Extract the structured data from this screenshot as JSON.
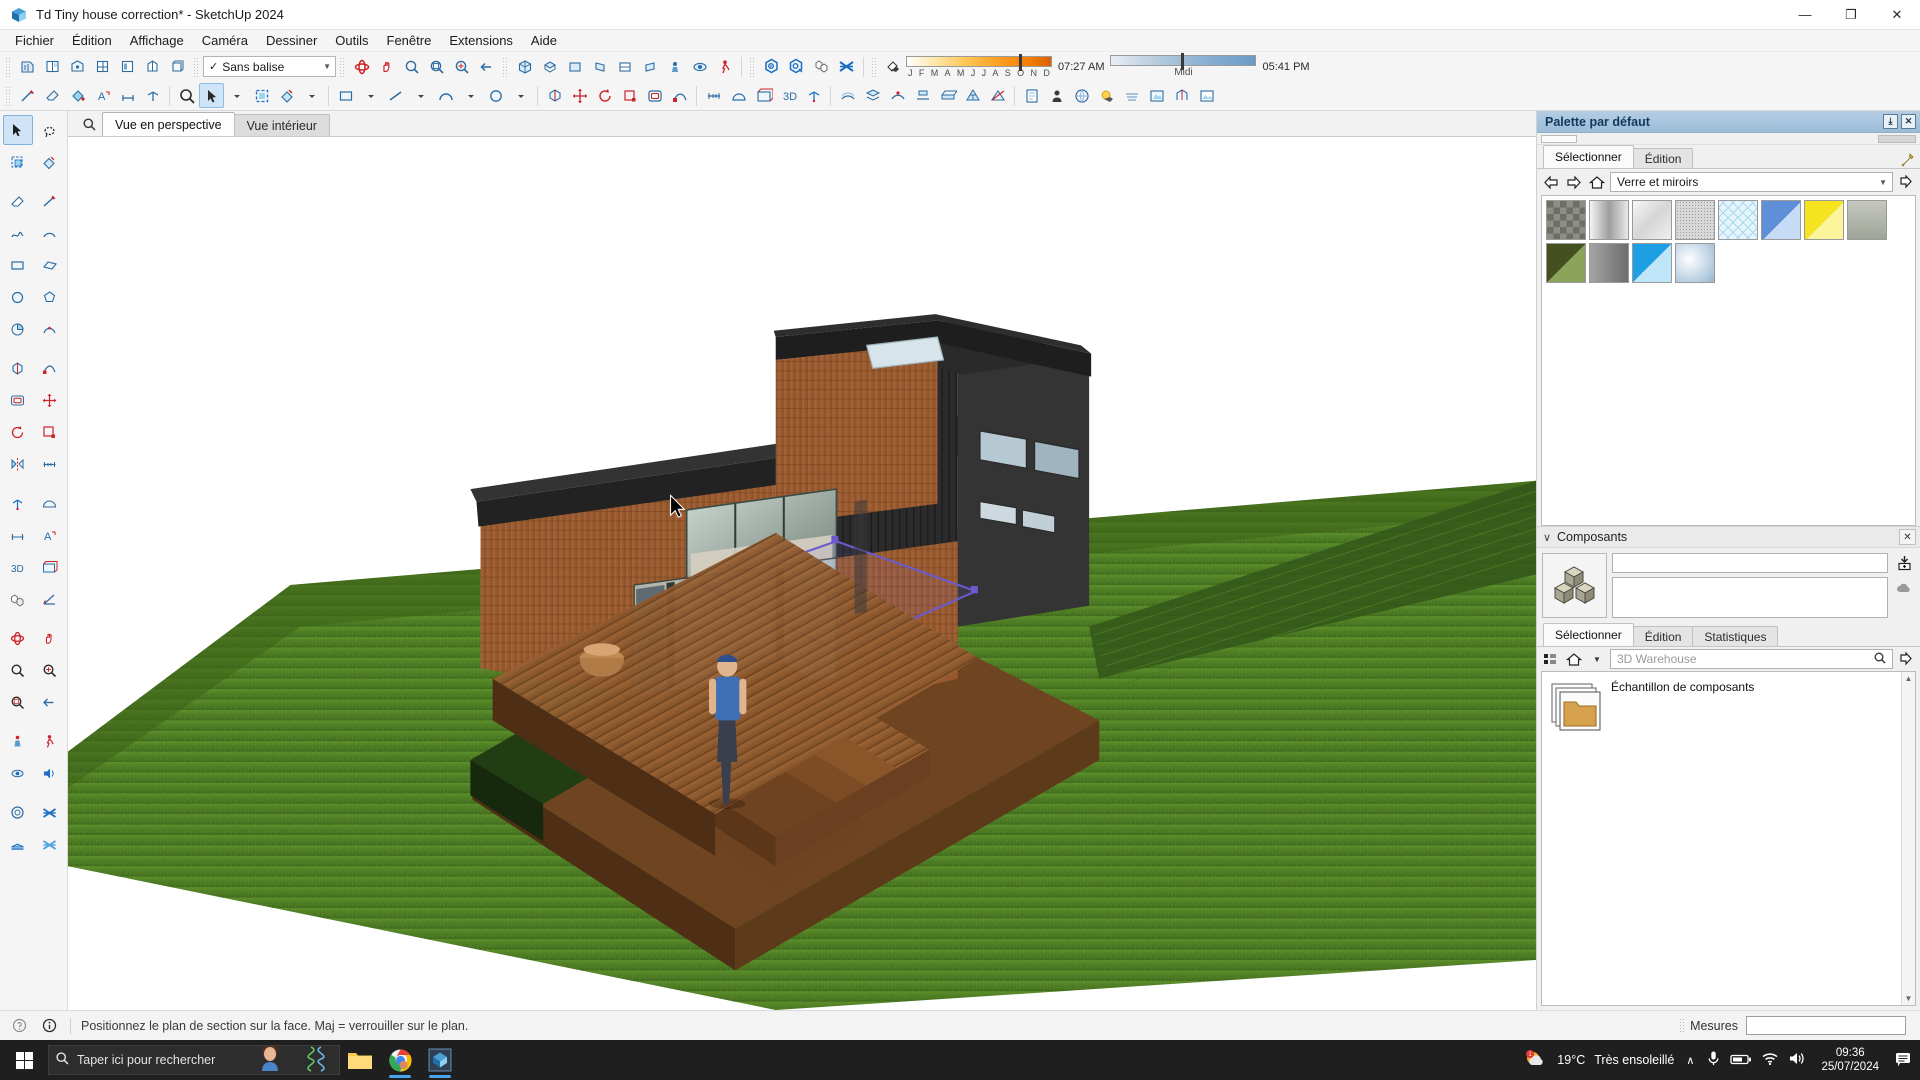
{
  "window": {
    "title": "Td Tiny house correction* - SketchUp 2024",
    "app_icon": "sketchup-icon",
    "minimize": "—",
    "maximize": "❐",
    "close": "✕"
  },
  "menubar": {
    "items": [
      {
        "label": "Fichier"
      },
      {
        "label": "Édition"
      },
      {
        "label": "Affichage"
      },
      {
        "label": "Caméra"
      },
      {
        "label": "Dessiner"
      },
      {
        "label": "Outils"
      },
      {
        "label": "Fenêtre"
      },
      {
        "label": "Extensions"
      },
      {
        "label": "Aide"
      }
    ]
  },
  "toolbar": {
    "tag_selector": {
      "check": "✓",
      "value": "Sans balise",
      "arrow": "▼"
    },
    "shadow": {
      "months": [
        "J",
        "F",
        "M",
        "A",
        "M",
        "J",
        "J",
        "A",
        "S",
        "O",
        "N",
        "D"
      ],
      "sunrise": "07:27 AM",
      "noon_label": "Midi",
      "sunset": "05:41 PM"
    }
  },
  "view_tabs": {
    "search_icon": "search-icon",
    "tabs": [
      {
        "label": "Vue en perspective",
        "active": true
      },
      {
        "label": "Vue intérieur",
        "active": false
      }
    ]
  },
  "palette_panel": {
    "title": "Palette par défaut",
    "pin_glyph": "⤓",
    "close_glyph": "✕",
    "tabs": [
      {
        "label": "Sélectionner",
        "active": true
      },
      {
        "label": "Édition",
        "active": false
      }
    ],
    "eyedropper_icon": "eyedropper-icon",
    "nav": {
      "back_icon": "arrow-left-icon",
      "forward_icon": "arrow-right-icon",
      "home_icon": "home-icon",
      "details_icon": "details-arrow-icon"
    },
    "material_library": {
      "value": "Verre et miroirs",
      "arrow": "▼"
    },
    "swatches": [
      {
        "name": "verre-quadrille",
        "color": "#8e8e88"
      },
      {
        "name": "verre-degrade-clair",
        "color": "#d8d8d8"
      },
      {
        "name": "verre-translucide",
        "color": "#e6e6e6"
      },
      {
        "name": "verre-givre",
        "color": "#d2d2d2"
      },
      {
        "name": "verre-treillis-bleu",
        "color": "#cfe7f5"
      },
      {
        "name": "verre-bleu-ciel",
        "color": "#5e8fd8"
      },
      {
        "name": "verre-jaune",
        "color": "#f6e31f"
      },
      {
        "name": "miroir-gris-clair",
        "color": "#b9bcb4"
      },
      {
        "name": "verre-vert-olive",
        "color": "#6d8040"
      },
      {
        "name": "miroir-gris-fonce",
        "color": "#7d7d7d"
      },
      {
        "name": "verre-cyan",
        "color": "#2aa8e8"
      },
      {
        "name": "verre-nuage",
        "color": "#c6d8ea"
      }
    ]
  },
  "components_panel": {
    "header": {
      "collapse_glyph": "∨",
      "title": "Composants",
      "close_glyph": "✕"
    },
    "thumb_icon": "component-cubes-icon",
    "side_icons": [
      "save-component-icon",
      "cloud-component-icon"
    ],
    "tabs": [
      {
        "label": "Sélectionner",
        "active": true
      },
      {
        "label": "Édition",
        "active": false
      },
      {
        "label": "Statistiques",
        "active": false
      }
    ],
    "warehouse_search": {
      "grid_icon": "grid-view-icon",
      "home_icon": "home-icon",
      "dropdown_arrow": "▼",
      "placeholder": "3D Warehouse",
      "search_icon": "search-icon",
      "open_icon": "details-arrow-icon"
    },
    "list": [
      {
        "label": "Échantillon de composants",
        "icon": "folder-icon"
      }
    ]
  },
  "statusbar": {
    "help_icon": "help-circle-icon",
    "info_icon": "info-circle-icon",
    "message": "Positionnez le plan de section sur la face.  Maj = verrouiller sur le plan.",
    "measures_label": "Mesures",
    "measures_value": ""
  },
  "taskbar": {
    "start_icon": "windows-start-icon",
    "search": {
      "icon": "search-icon",
      "placeholder": "Taper ici pour rechercher"
    },
    "apps": [
      {
        "name": "file-explorer-icon",
        "open": false
      },
      {
        "name": "google-chrome-icon",
        "open": true
      },
      {
        "name": "sketchup-icon",
        "open": true
      }
    ],
    "tray": {
      "weather_temp": "19°C",
      "weather_desc": "Très ensoleillé",
      "chevron": "∧",
      "icons": [
        "microphone-icon",
        "battery-icon",
        "wifi-icon",
        "volume-icon"
      ],
      "time": "09:36",
      "date": "25/07/2024",
      "notifications_icon": "notifications-icon"
    }
  },
  "viewport": {
    "model_name": "tiny-house-3d-model",
    "section_plane_color": "#6a5acd",
    "ground_color": "#4a7a22",
    "wood_color": "#9a5a2c",
    "roof_color": "#2b2b2b"
  },
  "colors": {
    "titlebar_bg": "#ffffff",
    "toolbar_bg": "#f5f5f5",
    "panel_header": "#a8c4de",
    "accent_blue": "#1b6ec2",
    "tool_red": "#cc2229",
    "taskbar_bg": "#1f1f1f"
  }
}
